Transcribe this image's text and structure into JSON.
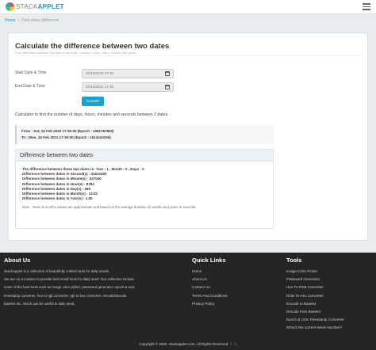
{
  "header": {
    "logo_stack": "STACK",
    "logo_applet": "APPLET"
  },
  "breadcrumb": {
    "home": "Home",
    "separator": "/",
    "current": "Find dates difference"
  },
  "tool": {
    "title": "Calculate the difference between two dates",
    "subtitle": "Find difference between two date in seconds, minutes, hours, days, months and years",
    "start_label": "Start Date & Time",
    "start_value": "02/15/2020 17:30",
    "end_label": "End Date & Time",
    "end_value": "02/15/2021 17:30",
    "convert_label": "Convert",
    "description": "Calculator to find the number of days, hours, minutes and seconds between 2 dates."
  },
  "summary": {
    "from": "From : Sat, 15 Feb 2020 17:30:00 (Epoch : 1581787800)",
    "to": "To : Mon, 15 Feb 2021 17:30:00 (Epoch : 1613410200)"
  },
  "result": {
    "heading": "Difference between two dates",
    "lines": [
      "The difference between these two dates is: Year : 1 , Month : 0 , Days : 2",
      "Difference between dates in Second(s) : 31622400",
      "Difference between dates in Minute(s) : 527040",
      "Difference between dates in Hour(s) : 8784",
      "Difference between dates in Day(s) : 366",
      "Difference between dates in Month(s) : 12.02",
      "Difference between dates in Year(s) : 1.00"
    ],
    "note": "Note : Years & months values are approximate and based on the average duration of months and years in seconds."
  },
  "footer": {
    "about_title": "About Us",
    "about_lines": [
      "StackApplet is a collection of beautifully crafted tools for daily needs.",
      "We are on a mission to provide best small tools for daily need. Our collection include",
      "some of the best tools such as image color picker, password generator, epoch & unix",
      "timestamp converter, hex to rgb converter, rgb to hex converter, encode/decode",
      "base64 etc. which can be useful in daily need."
    ],
    "quick_title": "Quick Links",
    "quick_links": [
      "Home",
      "About Us",
      "Contact Us",
      "Terms And Conditions",
      "Privacy Policy"
    ],
    "tools_title": "Tools",
    "tools": [
      "Image Color Picker",
      "Password Generator",
      "Hex To RGB Converter",
      "RGB To Hex Converter",
      "Encode to Base64",
      "Decode from Base64",
      "Epoch & Unix Timestamp Converter",
      "What's the current Week Number?"
    ],
    "copyright": "Copyright © 2020, stackapplet.com, All Rights Reserved",
    "social_icons": [
      "facebook-icon",
      "twitter-icon"
    ]
  }
}
